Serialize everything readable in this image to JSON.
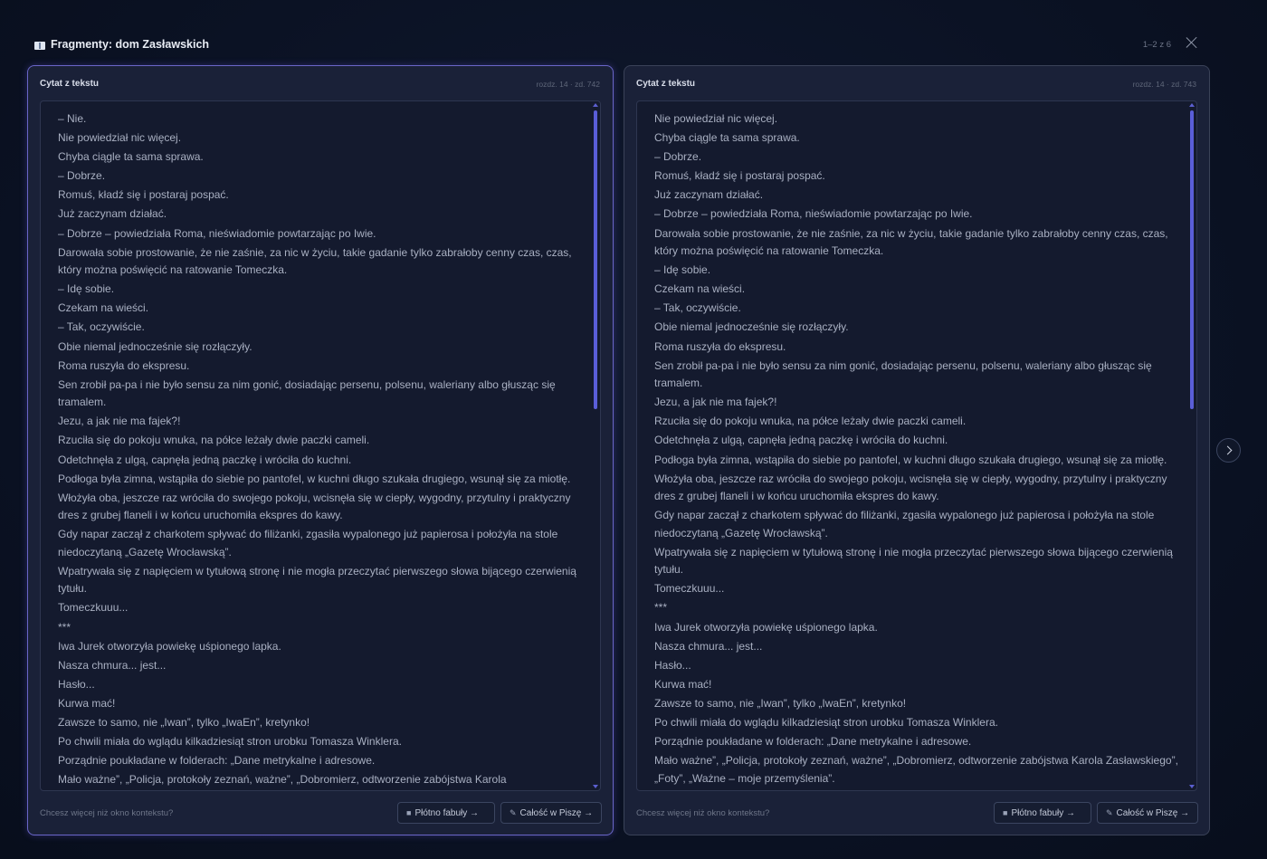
{
  "header": {
    "title": "Fragmenty: dom Zasławskich",
    "pager": "1–2 z 6",
    "icon": "book-icon",
    "close_icon": "close-icon"
  },
  "cards": [
    {
      "title": "Cytat z tekstu",
      "meta": "rozdz. 14 · zd. 742",
      "lines": [
        "– Nie.",
        "Nie powiedział nic więcej.",
        "Chyba ciągle ta sama sprawa.",
        "– Dobrze.",
        "Romuś, kładź się i postaraj pospać.",
        "Już zaczynam działać.",
        "– Dobrze – powiedziała Roma, nieświadomie powtarzając po Iwie.",
        "Darowała sobie prostowanie, że nie zaśnie, za nic w życiu, takie gadanie tylko zabrałoby cenny czas, czas, który można poświęcić na ratowanie Tomeczka.",
        "– Idę sobie.",
        "Czekam na wieści.",
        "– Tak, oczywiście.",
        "Obie niemal jednocześnie się rozłączyły.",
        "Roma ruszyła do ekspresu.",
        "Sen zrobił pa-pa i nie było sensu za nim gonić, dosiadając persenu, polsenu, waleriany albo głusząc się tramalem.",
        "Jezu, a jak nie ma fajek?!",
        "Rzuciła się do pokoju wnuka, na półce leżały dwie paczki cameli.",
        "Odetchnęła z ulgą, capnęła jedną paczkę i wróciła do kuchni.",
        "Podłoga była zimna, wstąpiła do siebie po pantofel, w kuchni długo szukała drugiego, wsunął się za miotłę.",
        "Włożyła oba, jeszcze raz wróciła do swojego pokoju, wcisnęła się w ciepły, wygodny, przytulny i praktyczny dres z grubej flaneli i w końcu uruchomiła ekspres do kawy.",
        "Gdy napar zaczął z charkotem spływać do filiżanki, zgasiła wypalonego już papierosa i położyła na stole niedoczytaną „Gazetę Wrocławską”.",
        "Wpatrywała się z napięciem w tytułową stronę i nie mogła przeczytać pierwszego słowa bijącego czerwienią tytułu.",
        "Tomeczkuuu...",
        "***",
        "Iwa Jurek otworzyła powiekę uśpionego lapka.",
        "Nasza chmura... jest...",
        "Hasło...",
        "Kurwa mać!",
        "Zawsze to samo, nie „Iwan”, tylko „IwaEn”, kretynko!",
        "Po chwili miała do wglądu kilkadziesiąt stron urobku Tomasza Winklera.",
        "Porządnie poukładane w folderach: „Dane metrykalne i adresowe.",
        "Mało ważne”, „Policja, protokoły zeznań, ważne”, „Dobromierz, odtworzenie zabójstwa Karola"
      ],
      "footer_note": "Chcesz więcej niż okno kontekstu?",
      "buttons": [
        "Płótno fabuły →",
        "Całość w Piszę →"
      ]
    },
    {
      "title": "Cytat z tekstu",
      "meta": "rozdz. 14 · zd. 743",
      "lines": [
        "Nie powiedział nic więcej.",
        "Chyba ciągle ta sama sprawa.",
        "– Dobrze.",
        "Romuś, kładź się i postaraj pospać.",
        "Już zaczynam działać.",
        "– Dobrze – powiedziała Roma, nieświadomie powtarzając po Iwie.",
        "Darowała sobie prostowanie, że nie zaśnie, za nic w życiu, takie gadanie tylko zabrałoby cenny czas, czas, który można poświęcić na ratowanie Tomeczka.",
        "– Idę sobie.",
        "Czekam na wieści.",
        "– Tak, oczywiście.",
        "Obie niemal jednocześnie się rozłączyły.",
        "Roma ruszyła do ekspresu.",
        "Sen zrobił pa-pa i nie było sensu za nim gonić, dosiadając persenu, polsenu, waleriany albo głusząc się tramalem.",
        "Jezu, a jak nie ma fajek?!",
        "Rzuciła się do pokoju wnuka, na półce leżały dwie paczki cameli.",
        "Odetchnęła z ulgą, capnęła jedną paczkę i wróciła do kuchni.",
        "Podłoga była zimna, wstąpiła do siebie po pantofel, w kuchni długo szukała drugiego, wsunął się za miotłę.",
        "Włożyła oba, jeszcze raz wróciła do swojego pokoju, wcisnęła się w ciepły, wygodny, przytulny i praktyczny dres z grubej flaneli i w końcu uruchomiła ekspres do kawy.",
        "Gdy napar zaczął z charkotem spływać do filiżanki, zgasiła wypalonego już papierosa i położyła na stole niedoczytaną „Gazetę Wrocławską”.",
        "Wpatrywała się z napięciem w tytułową stronę i nie mogła przeczytać pierwszego słowa bijącego czerwienią tytułu.",
        "Tomeczkuuu...",
        "***",
        "Iwa Jurek otworzyła powiekę uśpionego lapka.",
        "Nasza chmura... jest...",
        "Hasło...",
        "Kurwa mać!",
        "Zawsze to samo, nie „Iwan”, tylko „IwaEn”, kretynko!",
        "Po chwili miała do wglądu kilkadziesiąt stron urobku Tomasza Winklera.",
        "Porządnie poukładane w folderach: „Dane metrykalne i adresowe.",
        "Mało ważne”, „Policja, protokoły zeznań, ważne”, „Dobromierz, odtworzenie zabójstwa Karola Zasławskiego”, „Foty”, „Ważne – moje przemyślenia”."
      ],
      "footer_note": "Chcesz więcej niż okno kontekstu?",
      "buttons": [
        "Płótno fabuły →",
        "Całość w Piszę →"
      ]
    }
  ],
  "nav": {
    "next_icon": "chevron-right-icon"
  },
  "colors": {
    "accent": "#5a5ed8",
    "background": "#0b1224",
    "card": "#1a2138"
  }
}
